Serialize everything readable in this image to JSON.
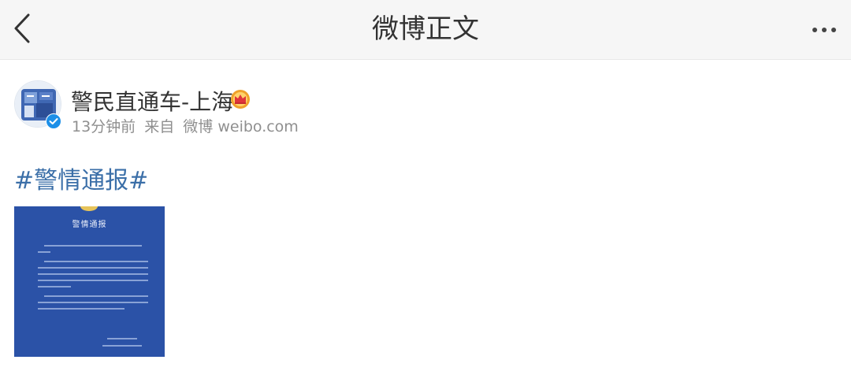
{
  "header": {
    "title": "微博正文",
    "back_icon": "chevron-left-icon",
    "more_icon": "more-dots-icon"
  },
  "post": {
    "author": {
      "name": "警民直通车-上海",
      "avatar_icon": "avatar",
      "verified_icon": "verified-check-icon",
      "vip_icon": "crown-badge-icon"
    },
    "meta": {
      "time": "13分钟前",
      "source_prefix": "来自",
      "source": "微博 weibo.com"
    },
    "hashtag": "#警情通报#",
    "image": {
      "title": "警情通报",
      "background_color": "#2b52a7"
    }
  },
  "colors": {
    "link_blue": "#3b6fa8",
    "verified_blue": "#1c8fe8",
    "crown_orange": "#f0a12b"
  }
}
